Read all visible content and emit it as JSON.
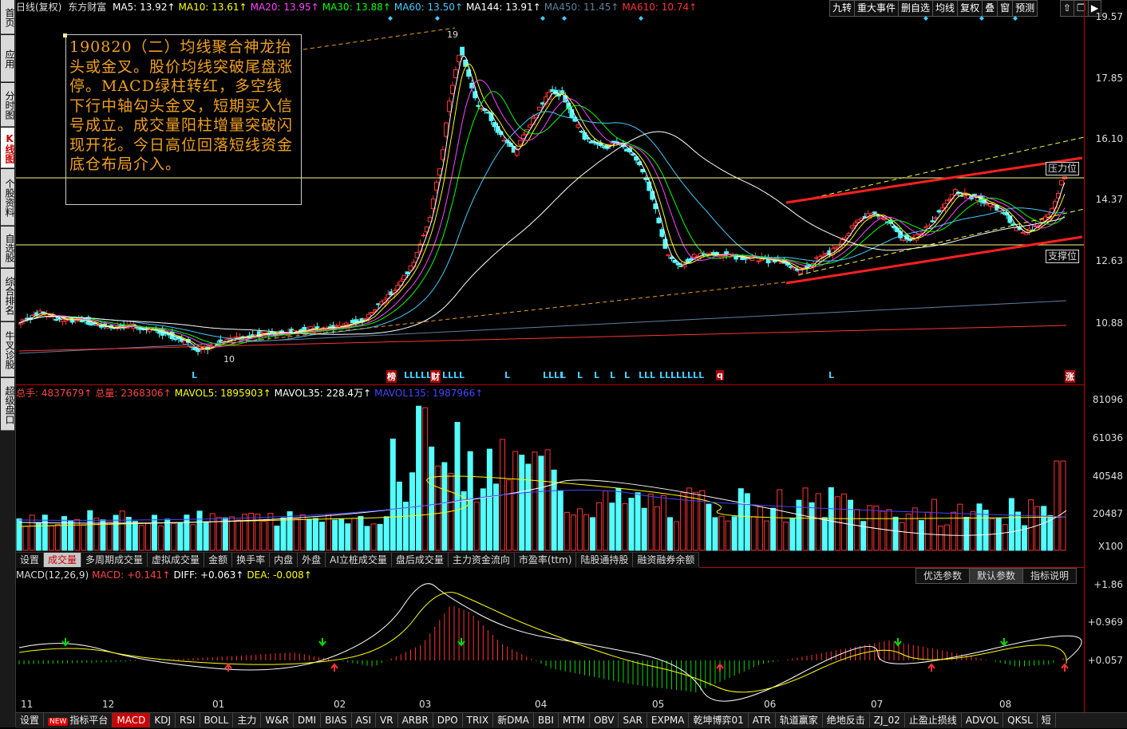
{
  "left_tabs": [
    {
      "label": "首页",
      "active": false
    },
    {
      "label": "应用",
      "active": false
    },
    {
      "label": "分时图",
      "active": false
    },
    {
      "label": "K线图",
      "active": true
    },
    {
      "label": "个股资料",
      "active": false
    },
    {
      "label": "自选股",
      "active": false
    },
    {
      "label": "综合排名",
      "active": false
    },
    {
      "label": "牛叉诊股",
      "active": false
    },
    {
      "label": "超级盘口",
      "active": false
    }
  ],
  "header": {
    "period": "日线(复权)",
    "stock": "东方财富",
    "mas": [
      {
        "label": "MA5: 13.92↑",
        "color": "#ffffff"
      },
      {
        "label": "MA10: 13.61↑",
        "color": "#ffff00"
      },
      {
        "label": "MA20: 13.95↑",
        "color": "#ff44ff"
      },
      {
        "label": "MA30: 13.88↑",
        "color": "#00ff00"
      },
      {
        "label": "MA60: 13.50↑",
        "color": "#44ccff"
      },
      {
        "label": "MA144: 13.91↑",
        "color": "#ffffff"
      },
      {
        "label": "MA450: 11.45↑",
        "color": "#5c7fa0"
      },
      {
        "label": "MA610: 10.74↑",
        "color": "#ff3333"
      }
    ]
  },
  "toolbar": [
    "九转",
    "重大事件",
    "删自选",
    "均线",
    "复权",
    "叠",
    "窗",
    "预测"
  ],
  "price_axis": [
    "19.57",
    "17.85",
    "16.10",
    "14.37",
    "12.63",
    "10.88"
  ],
  "annotation": "190820（二）均线聚合神龙抬头或金叉。股价均线突破尾盘涨停。MACD绿柱转红，多空线下行中轴勾头金叉，短期买入信号成立。成交量阳柱增量突破闪现开花。今日高位回落短线资金底仓布局介入。",
  "chart_labels": {
    "high": "19",
    "low": "10",
    "resistance": "压力位",
    "support": "支撑位"
  },
  "signal_markers": [
    "L",
    "榜",
    "LLLLL",
    "财",
    "LLLL",
    "L",
    "LLLL",
    "L",
    "L",
    "L",
    "L",
    "L",
    "LLL",
    "LLLLLLLL",
    "q",
    "L",
    "涨"
  ],
  "volume": {
    "header": [
      {
        "label": "总手: 4837679↑",
        "color": "#ff4444"
      },
      {
        "label": "总量: 2368306↑",
        "color": "#ff4444"
      },
      {
        "label": "MAVOL5: 1895903↑",
        "color": "#ffff00"
      },
      {
        "label": "MAVOL35: 228.4万↑",
        "color": "#ffffff"
      },
      {
        "label": "MAVOL135: 1987966↑",
        "color": "#4444ff"
      }
    ],
    "axis": [
      "81096",
      "61036",
      "40548",
      "20487",
      "X100"
    ],
    "tabs": [
      "设置",
      "成交量",
      "多周期成交量",
      "虚拟成交量",
      "金额",
      "换手率",
      "内盘",
      "外盘",
      "AI立桩成交量",
      "盘后成交量",
      "主力资金流向",
      "市盈率(ttm)",
      "陆股通持股",
      "融资融券余额"
    ],
    "active_tab": "成交量"
  },
  "macd": {
    "header": [
      {
        "label": "MACD(12,26,9)",
        "color": "#dddddd"
      },
      {
        "label": "MACD: +0.141↑",
        "color": "#ff4444"
      },
      {
        "label": "DIFF: +0.063↑",
        "color": "#ffffff"
      },
      {
        "label": "DEA: -0.008↑",
        "color": "#ffff00"
      }
    ],
    "param_tabs": [
      "优选参数",
      "默认参数",
      "指标说明"
    ],
    "active_param": "默认参数",
    "axis": [
      "+1.86",
      "+0.969",
      "+0.057"
    ]
  },
  "x_axis": [
    "11",
    "12",
    "01",
    "02",
    "03",
    "04",
    "05",
    "06",
    "07",
    "08"
  ],
  "bottom_tabs": [
    "设置",
    "指标平台",
    "MACD",
    "KDJ",
    "RSI",
    "BOLL",
    "主力",
    "W&R",
    "DMI",
    "BIAS",
    "ASI",
    "VR",
    "ARBR",
    "DPO",
    "TRIX",
    "新DMA",
    "BBI",
    "MTM",
    "OBV",
    "SAR",
    "EXPMA",
    "乾坤博弈01",
    "ATR",
    "轨道赢家",
    "绝地反击",
    "ZJ_02",
    "止盈止损线",
    "ADVOL",
    "QKSL",
    "短"
  ],
  "bottom_active": "MACD",
  "bottom_new_badge": "NEW",
  "colors": {
    "up": "#ff3333",
    "down": "#54ffff",
    "accent": "#cc0000"
  }
}
